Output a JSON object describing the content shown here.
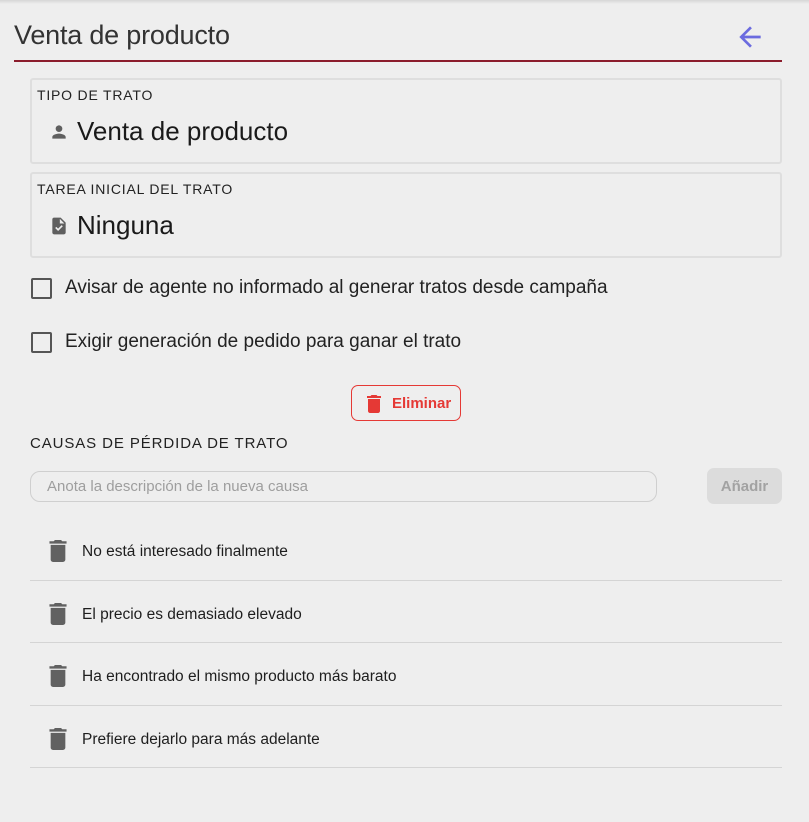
{
  "header": {
    "title": "Venta de producto",
    "back_icon": "arrow-left-icon",
    "accent_color": "#6b6bdf",
    "underline_color": "#8b1c2c"
  },
  "deal_type": {
    "label": "TIPO DE TRATO",
    "icon": "person-icon",
    "value": "Venta de producto"
  },
  "initial_task": {
    "label": "TAREA INICIAL DEL TRATO",
    "icon": "task-document-icon",
    "value": "Ninguna"
  },
  "options": [
    {
      "label": "Avisar de agente no informado al generar tratos desde campaña",
      "checked": false
    },
    {
      "label": "Exigir generación de pedido para ganar el trato",
      "checked": false
    }
  ],
  "delete_button": {
    "label": "Eliminar",
    "icon": "trash-icon",
    "color": "#e53935"
  },
  "loss_causes": {
    "title": "CAUSAS DE PÉRDIDA DE TRATO",
    "input_placeholder": "Anota la descripción de la nueva causa",
    "input_value": "",
    "add_label": "Añadir",
    "items": [
      {
        "label": "No está interesado finalmente",
        "icon": "trash-icon"
      },
      {
        "label": "El precio es demasiado elevado",
        "icon": "trash-icon"
      },
      {
        "label": "Ha encontrado el mismo producto más barato",
        "icon": "trash-icon"
      },
      {
        "label": "Prefiere dejarlo para más adelante",
        "icon": "trash-icon"
      }
    ]
  }
}
